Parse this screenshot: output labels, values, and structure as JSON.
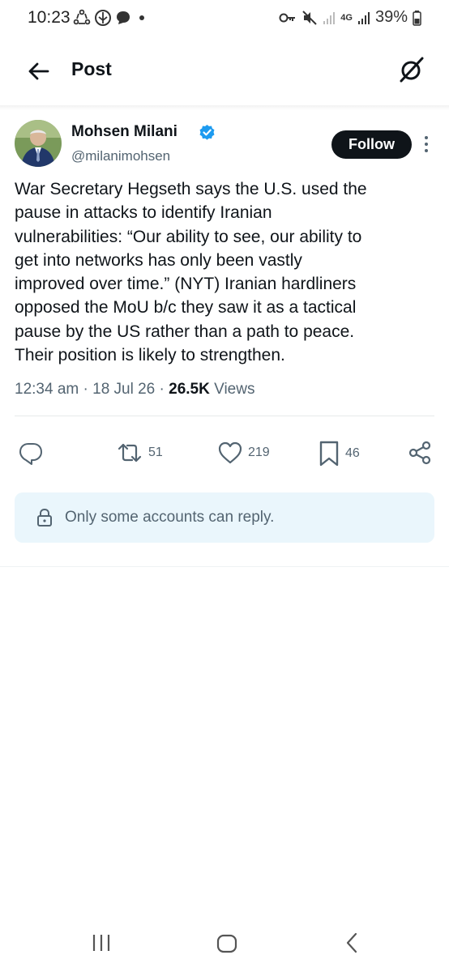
{
  "status_bar": {
    "time": "10:23",
    "network_label": "4G",
    "battery_percent": "39%",
    "left_icons": [
      "sync-icon",
      "carrier-icon",
      "chat-bubble-icon",
      "dot-icon"
    ],
    "right_icons": [
      "key-icon",
      "mute-icon",
      "signal-icon",
      "signal-icon",
      "battery-icon"
    ]
  },
  "header": {
    "title": "Post",
    "back_icon": "arrow-left-icon",
    "action_icon": "grok-icon"
  },
  "post": {
    "author_name": "Mohsen Milani",
    "author_handle": "@milanimohsen",
    "verified": true,
    "follow_label": "Follow",
    "text": "War Secretary Hegseth says the U.S. used the\npause in attacks to identify Iranian\nvulnerabilities: “Our ability to see, our ability to\nget into networks has only been vastly\nimproved over time.” (NYT) Iranian hardliners\nopposed the MoU b/c they saw it as a tactical\npause by the US rather than a path to peace.\nTheir position is likely to strengthen.",
    "time": "12:34 am",
    "separator": "·",
    "date": "18 Jul 26",
    "views_count": "26.5K",
    "views_label": "Views"
  },
  "actions": {
    "reply_count": "",
    "repost_count": "51",
    "like_count": "219",
    "bookmark_count": "46"
  },
  "reply_notice": {
    "text": "Only some accounts can reply."
  },
  "colors": {
    "accent": "#1d9bf0",
    "text_primary": "#0f1419",
    "text_secondary": "#536471",
    "notice_bg": "#eaf6fc",
    "follow_bg": "#0f1419"
  }
}
